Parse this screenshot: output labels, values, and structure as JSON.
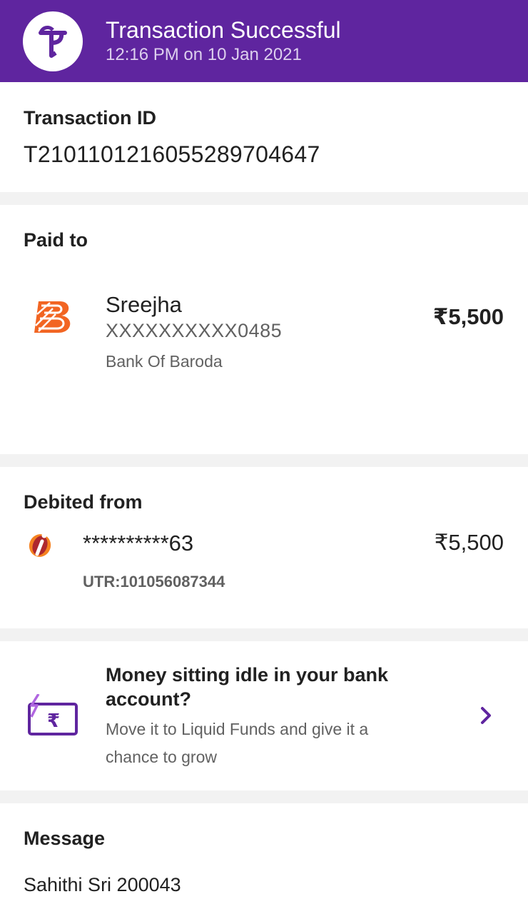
{
  "header": {
    "title": "Transaction Successful",
    "subtitle": "12:16 PM on 10 Jan 2021",
    "logo_icon": "phonepe-logo",
    "background": "#5f259f"
  },
  "transaction": {
    "label": "Transaction ID",
    "id": "T2101101216055289704647"
  },
  "paid_to": {
    "label": "Paid to",
    "bank_icon": "bank-of-baroda-logo",
    "name": "Sreejha",
    "account": "XXXXXXXXXX0485",
    "bank": "Bank Of Baroda",
    "amount": "₹5,500"
  },
  "debited_from": {
    "label": "Debited from",
    "bank_icon": "icici-bank-logo",
    "account": "**********63",
    "utr": "UTR:101056087344",
    "amount": "₹5,500"
  },
  "promo": {
    "icon": "rupee-wallet-icon",
    "title": "Money sitting idle in your bank account?",
    "description": "Move it to Liquid Funds and give it a chance to grow",
    "arrow_icon": "chevron-right-icon"
  },
  "message": {
    "label": "Message",
    "text": "Sahithi Sri 200043"
  }
}
